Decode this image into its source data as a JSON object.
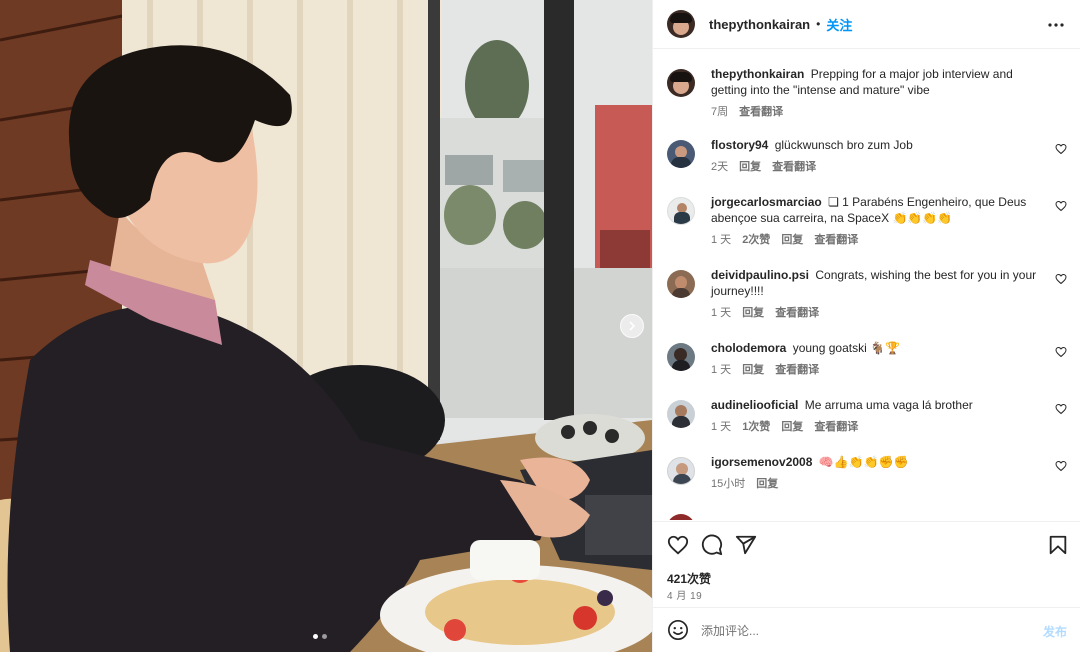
{
  "post": {
    "username": "thepythonkairan",
    "separator": "•",
    "follow_label": "关注",
    "more_icon": "more-horizontal-icon"
  },
  "caption": {
    "username": "thepythonkairan",
    "text": "Prepping for a major job interview and getting into the \"intense and mature\" vibe",
    "time": "7周",
    "translate": "查看翻译"
  },
  "comments": [
    {
      "username": "flostory94",
      "text": "glückwunsch bro zum Job",
      "time": "2天",
      "likes": "",
      "reply": "回复",
      "translate": "查看翻译"
    },
    {
      "username": "jorgecarlosmarciao",
      "text": "❏ 1 Parabéns Engenheiro, que Deus abençoe sua carreira, na SpaceX 👏👏👏👏",
      "time": "1 天",
      "likes": "2次赞",
      "reply": "回复",
      "translate": "查看翻译"
    },
    {
      "username": "deividpaulino.psi",
      "text": "Congrats, wishing the best for you in your journey!!!!",
      "time": "1 天",
      "likes": "",
      "reply": "回复",
      "translate": "查看翻译"
    },
    {
      "username": "cholodemora",
      "text": "young goatski 🐐🏆",
      "time": "1 天",
      "likes": "",
      "reply": "回复",
      "translate": "查看翻译"
    },
    {
      "username": "audineliooficial",
      "text": "Me arruma uma vaga lá brother",
      "time": "1 天",
      "likes": "1次赞",
      "reply": "回复",
      "translate": "查看翻译"
    },
    {
      "username": "igorsemenov2008",
      "text": "🧠👍👏👏✊✊",
      "time": "15小时",
      "likes": "",
      "reply": "回复",
      "translate": ""
    }
  ],
  "actions": {
    "like_icon": "heart-icon",
    "comment_icon": "comment-icon",
    "share_icon": "share-icon",
    "save_icon": "bookmark-icon"
  },
  "likes_count": "421次赞",
  "post_date": "4 月 19",
  "add_comment": {
    "placeholder": "添加评论...",
    "post_label": "发布",
    "emoji_icon": "emoji-icon"
  },
  "carousel": {
    "current": 1,
    "total": 2
  },
  "colors": {
    "accent": "#0095f6",
    "text": "#262626",
    "secondary": "#737373",
    "post_disabled": "#b3dbff"
  }
}
